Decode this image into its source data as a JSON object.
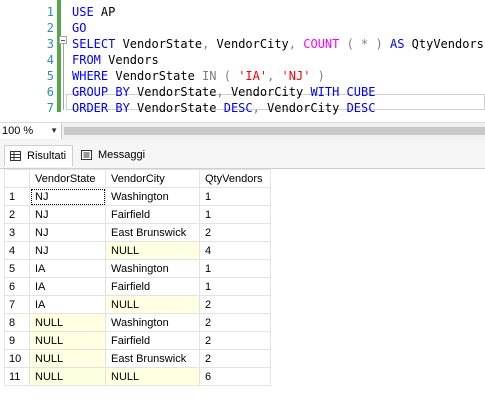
{
  "editor": {
    "lines": [
      {
        "num": "1",
        "tokens": [
          {
            "t": "USE",
            "c": "kw"
          },
          {
            "t": " AP",
            "c": ""
          }
        ]
      },
      {
        "num": "2",
        "tokens": [
          {
            "t": "GO",
            "c": "kw"
          }
        ]
      },
      {
        "num": "3",
        "tokens": [
          {
            "t": "SELECT",
            "c": "kw"
          },
          {
            "t": " VendorState",
            "c": ""
          },
          {
            "t": ",",
            "c": "op"
          },
          {
            "t": " VendorCity",
            "c": ""
          },
          {
            "t": ",",
            "c": "op"
          },
          {
            "t": " ",
            "c": ""
          },
          {
            "t": "COUNT",
            "c": "fn"
          },
          {
            "t": " ( * )",
            "c": "op"
          },
          {
            "t": " ",
            "c": ""
          },
          {
            "t": "AS",
            "c": "kw"
          },
          {
            "t": " QtyVendors",
            "c": ""
          }
        ]
      },
      {
        "num": "4",
        "tokens": [
          {
            "t": "FROM",
            "c": "kw"
          },
          {
            "t": " Vendors",
            "c": ""
          }
        ]
      },
      {
        "num": "5",
        "tokens": [
          {
            "t": "WHERE",
            "c": "kw"
          },
          {
            "t": " VendorState ",
            "c": ""
          },
          {
            "t": "IN",
            "c": "op"
          },
          {
            "t": " ( ",
            "c": "op"
          },
          {
            "t": "'IA'",
            "c": "str"
          },
          {
            "t": ", ",
            "c": "op"
          },
          {
            "t": "'NJ'",
            "c": "str"
          },
          {
            "t": " )",
            "c": "op"
          }
        ]
      },
      {
        "num": "6",
        "tokens": [
          {
            "t": "GROUP BY",
            "c": "kw"
          },
          {
            "t": " VendorState",
            "c": ""
          },
          {
            "t": ",",
            "c": "op"
          },
          {
            "t": " VendorCity ",
            "c": ""
          },
          {
            "t": "WITH CUBE",
            "c": "kw"
          }
        ]
      },
      {
        "num": "7",
        "tokens": [
          {
            "t": "ORDER BY",
            "c": "kw"
          },
          {
            "t": " VendorState ",
            "c": ""
          },
          {
            "t": "DESC",
            "c": "kw"
          },
          {
            "t": ",",
            "c": "op"
          },
          {
            "t": " VendorCity ",
            "c": ""
          },
          {
            "t": "DESC",
            "c": "kw"
          }
        ]
      }
    ]
  },
  "zoom": {
    "value": "100 %"
  },
  "tabs": {
    "results": "Risultati",
    "messages": "Messaggi"
  },
  "grid": {
    "columns": [
      "VendorState",
      "VendorCity",
      "QtyVendors"
    ],
    "rows": [
      [
        "1",
        "NJ",
        "Washington",
        "1"
      ],
      [
        "2",
        "NJ",
        "Fairfield",
        "1"
      ],
      [
        "3",
        "NJ",
        "East Brunswick",
        "2"
      ],
      [
        "4",
        "NJ",
        "NULL",
        "4"
      ],
      [
        "5",
        "IA",
        "Washington",
        "1"
      ],
      [
        "6",
        "IA",
        "Fairfield",
        "1"
      ],
      [
        "7",
        "IA",
        "NULL",
        "2"
      ],
      [
        "8",
        "NULL",
        "Washington",
        "2"
      ],
      [
        "9",
        "NULL",
        "Fairfield",
        "2"
      ],
      [
        "10",
        "NULL",
        "East Brunswick",
        "2"
      ],
      [
        "11",
        "NULL",
        "NULL",
        "6"
      ]
    ]
  },
  "colors": {
    "keyword": "#0000ff",
    "function": "#ff00ff",
    "string": "#ff0000",
    "operator": "#808080",
    "null_cell": "#ffffe1",
    "line_number": "#2b91af"
  }
}
